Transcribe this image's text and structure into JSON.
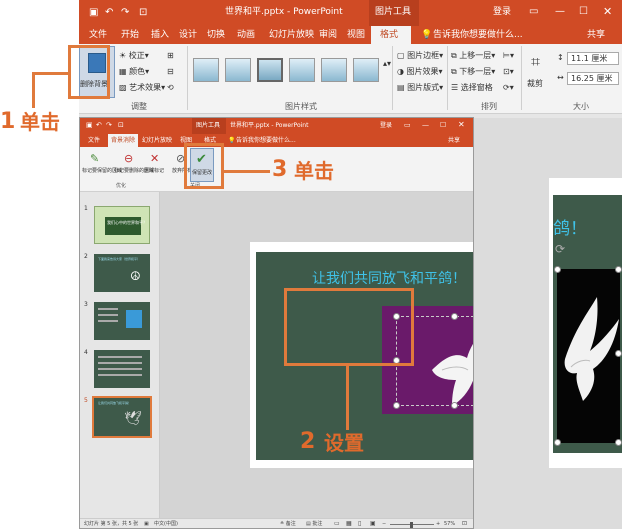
{
  "main_window": {
    "title": "世界和平.pptx - PowerPoint",
    "tool_context": "图片工具",
    "login": "登录",
    "tabs": [
      "文件",
      "开始",
      "插入",
      "设计",
      "切换",
      "动画",
      "幻灯片放映",
      "审阅",
      "视图",
      "格式"
    ],
    "tell_me": "告诉我你想要做什么...",
    "share": "共享",
    "ribbon": {
      "remove_bg": "删除背景",
      "corrections": "校正",
      "color": "颜色",
      "artistic": "艺术效果",
      "group_adjust": "调整",
      "group_styles": "图片样式",
      "border": "图片边框",
      "effects": "图片效果",
      "layout": "图片版式",
      "bring_forward": "上移一层",
      "send_backward": "下移一层",
      "selection_pane": "选择窗格",
      "group_arrange": "排列",
      "crop": "裁剪",
      "height": "11.1 厘米",
      "width": "16.25 厘米",
      "group_size": "大小"
    },
    "slide_title_partial": "鸽！"
  },
  "sub_window": {
    "title": "世界和平.pptx - PowerPoint",
    "tool_context": "图片工具",
    "login": "登录",
    "tabs": [
      "文件",
      "背景消除",
      "幻灯片放映",
      "视图",
      "格式"
    ],
    "tell_me": "告诉我你想要做什么...",
    "share": "共享",
    "ribbon": {
      "mark_keep": "标记要保留的区域",
      "mark_remove": "标记要删除的区域",
      "delete_mark": "删除标记",
      "discard_all": "放弃所有更改",
      "keep_changes": "保留更改",
      "group_optimize": "优化",
      "group_close": "关闭"
    },
    "thumbnails": [
      {
        "num": "1",
        "text": "我们心中的世界和平？"
      },
      {
        "num": "2",
        "text": "下面我来告诉大家（世界和平）"
      },
      {
        "num": "3",
        "text": ""
      },
      {
        "num": "4",
        "text": ""
      },
      {
        "num": "5",
        "text": "让我们共同放飞和平鸽！"
      }
    ],
    "slide_title": "让我们共同放飞和平鸽！",
    "status": {
      "slide_info": "幻灯片 第 5 张，共 5 张",
      "language": "中文(中国)",
      "notes": "备注",
      "comments": "批注",
      "zoom": "57%"
    }
  },
  "callouts": [
    {
      "num": "1",
      "text": "单击"
    },
    {
      "num": "3",
      "text": "单击"
    },
    {
      "num": "2",
      "text": "设置"
    }
  ],
  "colors": {
    "accent": "#d04b25",
    "callout": "#e06a2c",
    "slide_bg": "#3e5a4a",
    "selection_bg": "#6a1a6a"
  }
}
